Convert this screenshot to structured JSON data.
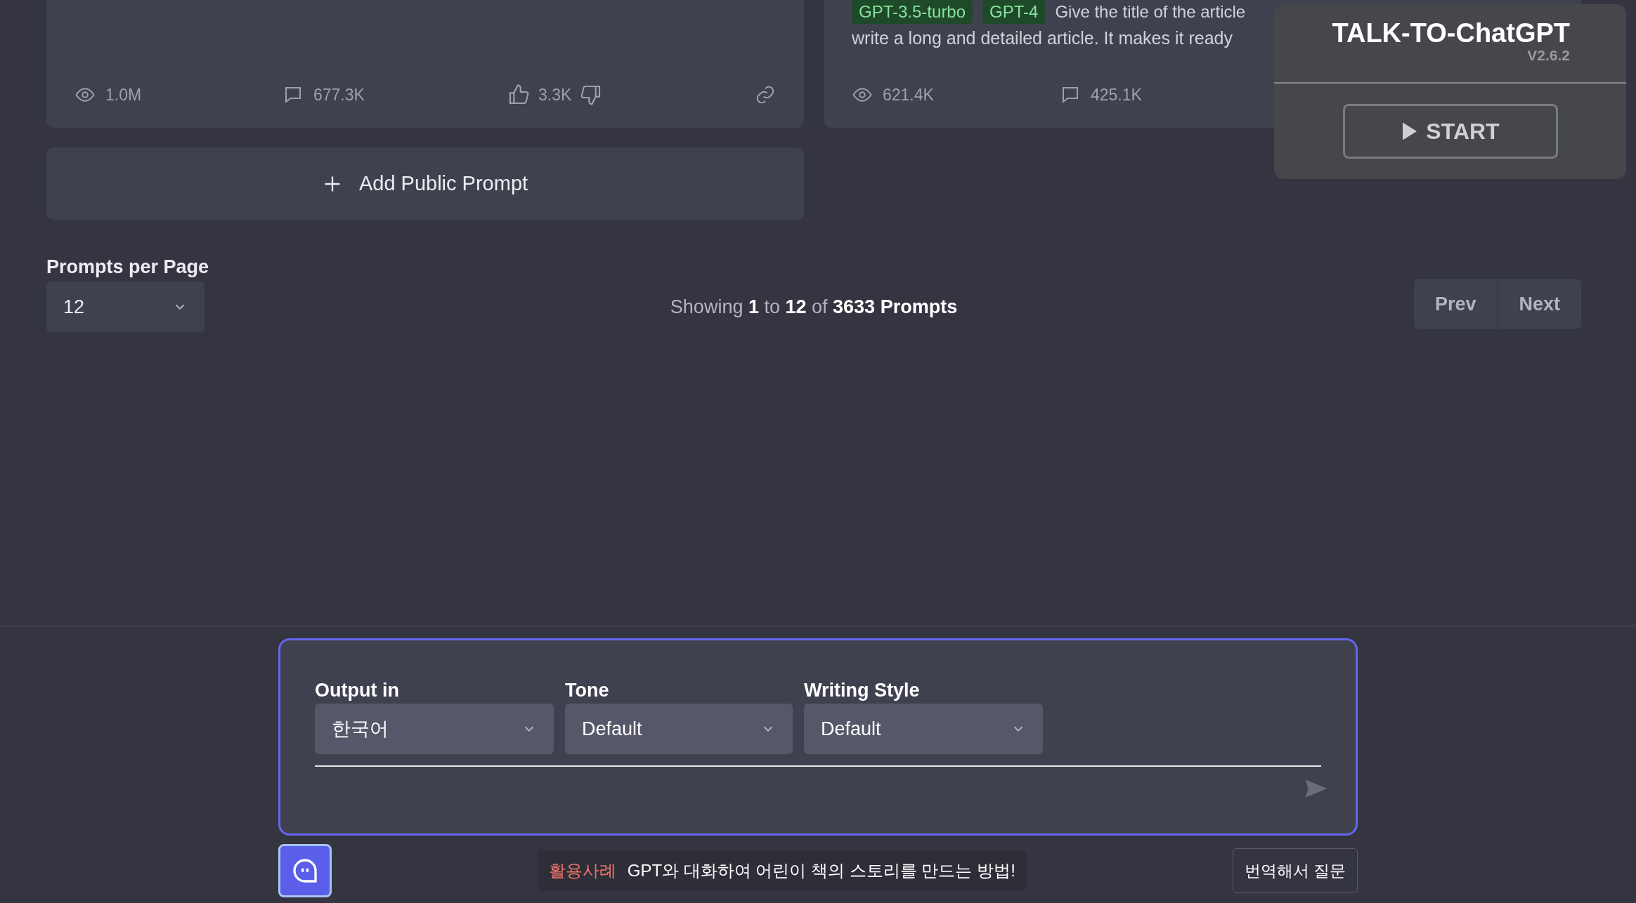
{
  "prompt_cards": [
    {
      "stats": {
        "views": "1.0M",
        "comments": "677.3K",
        "likes": "3.3K"
      },
      "show_votes": true,
      "show_link": true
    },
    {
      "tags": [
        "GPT-3.5-turbo",
        "GPT-4"
      ],
      "description_lines": [
        "Give the title of the article",
        "write a long and detailed article. It makes it ready"
      ],
      "stats": {
        "views": "621.4K",
        "comments": "425.1K"
      }
    }
  ],
  "add_button": {
    "label": "Add Public Prompt"
  },
  "pagination": {
    "per_page_label": "Prompts per Page",
    "per_page_value": "12",
    "summary": "Showing **1** to **12** of **3633 Prompts**",
    "prev": "Prev",
    "next": "Next"
  },
  "extension_panel": {
    "title": "TALK-TO-ChatGPT",
    "version": "V2.6.2",
    "start": "START"
  },
  "composer": {
    "selects": [
      {
        "label": "Output in",
        "value": "한국어"
      },
      {
        "label": "Tone",
        "value": "Default"
      },
      {
        "label": "Writing Style",
        "value": "Default"
      }
    ]
  },
  "footer": {
    "tip_tag": "활용사례",
    "tip_text": "GPT와 대화하여 어린이 책의 스토리를 만드는 방법!",
    "translate_button": "번역해서 질문"
  }
}
